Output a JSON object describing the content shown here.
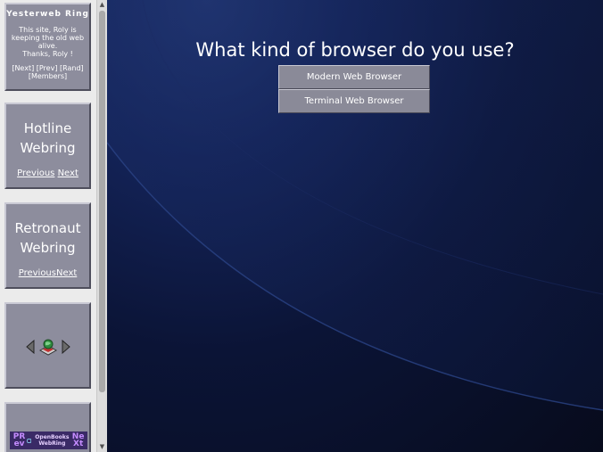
{
  "sidebar": {
    "yesterweb": {
      "title": "Yesterweb Ring",
      "text1": "This site, Roly is keeping the old web alive.",
      "text2": "Thanks, Roly !",
      "links": "[Next] [Prev] [Rand] [Members]"
    },
    "hotline": {
      "title": "Hotline Webring",
      "prev": "Previous",
      "next": "Next"
    },
    "retronaut": {
      "title": "Retronaut Webring",
      "prev": "Previous",
      "next": "Next"
    },
    "openbooks": {
      "prev": "PR ev",
      "name": "OpenBooks WebRing",
      "next": "Ne Xt"
    }
  },
  "main": {
    "question": "What kind of browser do you use?",
    "buttons": [
      {
        "label": "Modern Web Browser"
      },
      {
        "label": "Terminal Web Browser"
      }
    ]
  },
  "colors": {
    "card": "#8d8d9d",
    "background": "#0a1128",
    "button": "#8a8a98"
  }
}
